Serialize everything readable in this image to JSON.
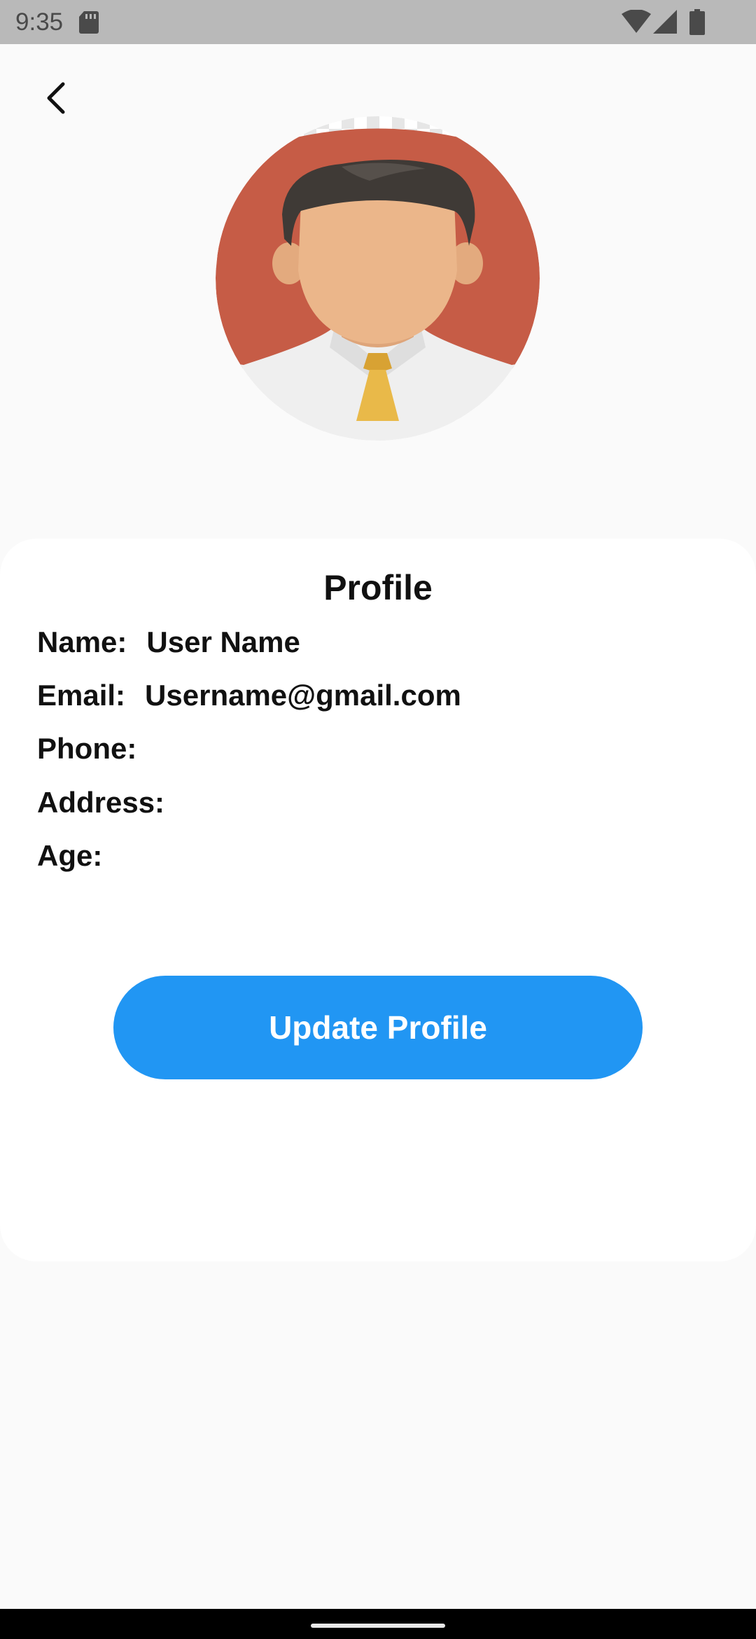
{
  "status_bar": {
    "time": "9:35",
    "icons": [
      "sd-card-icon",
      "wifi-icon",
      "signal-icon",
      "battery-icon"
    ]
  },
  "nav": {
    "back_icon": "chevron-left-icon"
  },
  "avatar": {
    "icon": "user-avatar-illustration",
    "colors": {
      "background": "#c65c46",
      "skin": "#ebb68a",
      "hair": "#3f3a36",
      "shirt": "#f0f0f0",
      "tie": "#e9b949"
    }
  },
  "card": {
    "title": "Profile",
    "fields": [
      {
        "label": "Name:",
        "value": "User Name"
      },
      {
        "label": "Email:",
        "value": "Username@gmail.com"
      },
      {
        "label": "Phone:",
        "value": ""
      },
      {
        "label": "Address:",
        "value": ""
      },
      {
        "label": "Age:",
        "value": ""
      }
    ],
    "update_button_label": "Update Profile"
  },
  "colors": {
    "accent": "#2196f3",
    "page_background": "#fafafa",
    "card_background": "#ffffff",
    "status_bar": "#b9b9b9"
  }
}
